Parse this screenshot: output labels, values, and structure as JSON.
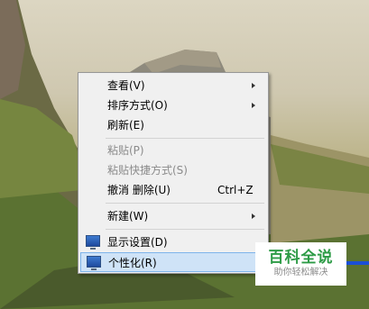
{
  "menu": {
    "items": [
      {
        "label": "查看(V)",
        "submenu": true
      },
      {
        "label": "排序方式(O)",
        "submenu": true
      },
      {
        "label": "刷新(E)"
      },
      {
        "label": "粘贴(P)",
        "disabled": true
      },
      {
        "label": "粘贴快捷方式(S)",
        "disabled": true
      },
      {
        "label": "撤消 删除(U)",
        "shortcut": "Ctrl+Z"
      },
      {
        "label": "新建(W)",
        "submenu": true
      },
      {
        "label": "显示设置(D)",
        "icon": "display-settings-icon"
      },
      {
        "label": "个性化(R)",
        "icon": "personalize-icon",
        "highlighted": true
      }
    ]
  },
  "watermark": {
    "title": "百科全说",
    "subtitle": "助你轻松解决"
  },
  "colors": {
    "menu_bg": "#f0f0f0",
    "highlight_bg": "#cfe3f7",
    "highlight_border": "#7eb4ea",
    "watermark_green": "#2d9b46"
  }
}
